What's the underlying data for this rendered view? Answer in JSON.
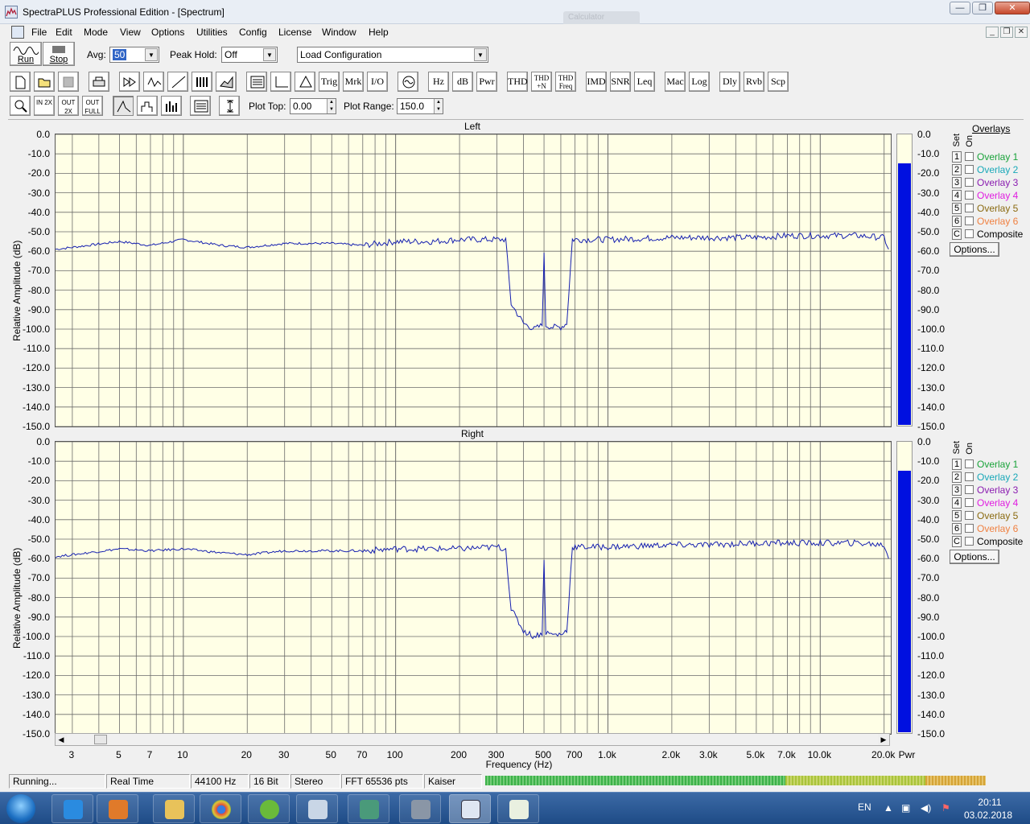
{
  "window": {
    "title": "SpectraPLUS Professional Edition - [Spectrum]",
    "ghost_tab": "Calculator"
  },
  "menu": [
    "File",
    "Edit",
    "Mode",
    "View",
    "Options",
    "Utilities",
    "Config",
    "License",
    "Window",
    "Help"
  ],
  "controls": {
    "run_label": "Run",
    "stop_label": "Stop",
    "avg_label": "Avg:",
    "avg_value": "50",
    "peak_hold_label": "Peak Hold:",
    "peak_hold_value": "Off",
    "load_config_value": "Load Configuration",
    "plot_top_label": "Plot Top:",
    "plot_top_value": "0.00",
    "plot_range_label": "Plot Range:",
    "plot_range_value": "150.0"
  },
  "toolbar_text_buttons": [
    "Trig",
    "Mrk",
    "I/O",
    "Hz",
    "dB",
    "Pwr",
    "THD",
    "THD +N",
    "THD Freq",
    "IMD",
    "SNR",
    "Leq",
    "Mac",
    "Log",
    "Dly",
    "Rvb",
    "Scp"
  ],
  "zoom_buttons": [
    "IN 2X",
    "OUT 2X",
    "OUT FULL"
  ],
  "plots": [
    {
      "title": "Left",
      "ylabel": "Relative Amplitude (dB)"
    },
    {
      "title": "Right",
      "ylabel": "Relative Amplitude (dB)"
    }
  ],
  "y_ticks": [
    "0.0",
    "-10.0",
    "-20.0",
    "-30.0",
    "-40.0",
    "-50.0",
    "-60.0",
    "-70.0",
    "-80.0",
    "-90.0",
    "-100.0",
    "-110.0",
    "-120.0",
    "-130.0",
    "-140.0",
    "-150.0"
  ],
  "x_ticks": [
    "3",
    "5",
    "7",
    "10",
    "20",
    "30",
    "50",
    "70",
    "100",
    "200",
    "300",
    "500",
    "700",
    "1.0k",
    "2.0k",
    "3.0k",
    "5.0k",
    "7.0k",
    "10.0k",
    "20.0k"
  ],
  "x_label": "Frequency (Hz)",
  "pwr_label": "Pwr",
  "overlays": {
    "heading": "Overlays",
    "set_label": "Set",
    "on_label": "On",
    "items": [
      {
        "num": "1",
        "label": "Overlay 1",
        "color": "#1aa33a"
      },
      {
        "num": "2",
        "label": "Overlay 2",
        "color": "#18a8b8"
      },
      {
        "num": "3",
        "label": "Overlay 3",
        "color": "#8a1cb0"
      },
      {
        "num": "4",
        "label": "Overlay 4",
        "color": "#e01ce0"
      },
      {
        "num": "5",
        "label": "Overlay 5",
        "color": "#8a6a10"
      },
      {
        "num": "6",
        "label": "Overlay 6",
        "color": "#f08040"
      },
      {
        "num": "C",
        "label": "Composite",
        "color": "#000000"
      }
    ],
    "options_label": "Options..."
  },
  "status": [
    "Running...",
    "Real Time",
    "44100 Hz",
    "16 Bit",
    "Stereo",
    "FFT 65536 pts",
    "Kaiser"
  ],
  "taskbar": {
    "lang": "EN",
    "time": "20:11",
    "date": "03.02.2018"
  },
  "chart_data": [
    {
      "type": "line",
      "title": "Left",
      "xlabel": "Frequency (Hz)",
      "ylabel": "Relative Amplitude (dB)",
      "x_scale": "log",
      "xlim": [
        2.5,
        21500
      ],
      "ylim": [
        -150,
        0
      ],
      "grid": true,
      "series": [
        {
          "x": [
            2.5,
            3,
            5,
            7,
            10,
            15,
            20,
            30,
            50,
            70,
            100,
            150,
            200,
            300,
            330,
            350,
            400,
            450,
            490,
            500,
            510,
            550,
            600,
            640,
            680,
            700,
            1000,
            2000,
            3000,
            5000,
            7000,
            10000,
            15000,
            20000,
            21000
          ],
          "y": [
            -59,
            -58,
            -55,
            -57,
            -54,
            -57,
            -58,
            -56,
            -56,
            -57,
            -55,
            -55,
            -54,
            -54,
            -54,
            -87,
            -97,
            -100,
            -98,
            -62,
            -98,
            -99,
            -99,
            -97,
            -54,
            -54,
            -54,
            -53,
            -53,
            -53,
            -52,
            -52,
            -52,
            -53,
            -59
          ]
        }
      ]
    },
    {
      "type": "line",
      "title": "Right",
      "xlabel": "Frequency (Hz)",
      "ylabel": "Relative Amplitude (dB)",
      "x_scale": "log",
      "xlim": [
        2.5,
        21500
      ],
      "ylim": [
        -150,
        0
      ],
      "grid": true,
      "series": [
        {
          "x": [
            2.5,
            3,
            5,
            7,
            10,
            15,
            20,
            30,
            50,
            70,
            100,
            150,
            200,
            300,
            330,
            350,
            400,
            450,
            490,
            500,
            510,
            550,
            600,
            640,
            680,
            700,
            1000,
            2000,
            3000,
            5000,
            7000,
            10000,
            15000,
            20000,
            21000
          ],
          "y": [
            -59,
            -58,
            -55,
            -56,
            -55,
            -57,
            -58,
            -56,
            -56,
            -56,
            -55,
            -55,
            -55,
            -54,
            -55,
            -86,
            -97,
            -100,
            -98,
            -61,
            -98,
            -99,
            -99,
            -97,
            -54,
            -54,
            -54,
            -53,
            -53,
            -52,
            -52,
            -52,
            -52,
            -53,
            -60
          ]
        }
      ]
    }
  ],
  "power_meters": [
    {
      "level_db": -15
    },
    {
      "level_db": -15
    }
  ]
}
